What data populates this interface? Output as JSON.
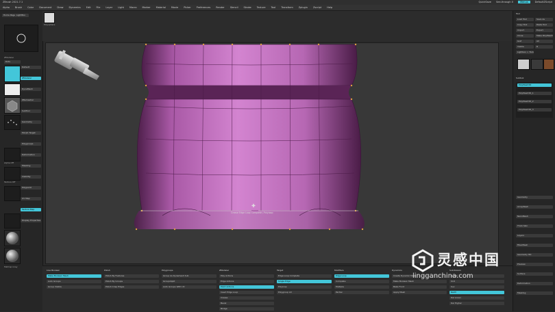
{
  "window": {
    "title": "ZBrush 2021.7.1",
    "status_right": [
      "QuickSave",
      "See-through 0",
      "Menus",
      "DefaultZScript"
    ]
  },
  "menu": {
    "items": [
      "Alpha",
      "Brush",
      "Color",
      "Document",
      "Draw",
      "Dynamics",
      "Edit",
      "File",
      "Layer",
      "Light",
      "Macro",
      "Marker",
      "Material",
      "Movie",
      "Picker",
      "Preferences",
      "Render",
      "Stencil",
      "Stroke",
      "Texture",
      "Tool",
      "Transform",
      "Zplugin",
      "Zscript",
      "Help"
    ]
  },
  "left_panel": {
    "buttons": [
      "Home Page",
      "LightBox",
      "Default",
      "ZModeler",
      "DynaMesh",
      "ZRemesher",
      "SubTool",
      "Geometry",
      "Morph Target",
      "Polygroups",
      "Deformation",
      "Masking",
      "Visibility",
      "Polypaint",
      "UV Map",
      "Texture Map",
      "Display Properties"
    ],
    "brush_label": "ZModeler",
    "stroke_label": "Dots",
    "alpha_label": "Alpha Off",
    "texture_label": "Texture Off",
    "material_label": "MatCap Gray"
  },
  "right_panel": {
    "header": "Tool",
    "buttons": [
      "Load Tool",
      "Save As",
      "Copy Tool",
      "Paste Tool",
      "Import",
      "Export",
      "Clone",
      "Make PolyMesh3D",
      "GoZ",
      "All",
      "Visible",
      "R",
      "Lightbox > Tools"
    ],
    "subtool_header": "Subtool",
    "subtools": [
      "PolyMesh3D",
      "PolyMesh3D_1",
      "PolyMesh3D_2",
      "PolyMesh3D_3"
    ],
    "sections": [
      "Geometry",
      "ArrayMesh",
      "NanoMesh",
      "Thick Skin",
      "Layers",
      "FiberMesh",
      "Geometry HD",
      "Preview",
      "Surface",
      "Deformation",
      "Masking"
    ]
  },
  "shelf": {
    "projection_label": "Polysphere"
  },
  "viewport": {
    "status_text": "Crease Edge Loop Complete / Polyloop"
  },
  "bottom_panel": {
    "groups": [
      {
        "title": "Live Boolean",
        "items": [
          "Make Boolean Mesh",
          "Auto Groups",
          "Group Visible"
        ]
      },
      {
        "title": "Polish",
        "items": [
          "Polish By Features",
          "Polish By Groups",
          "Polish Crisp Edges"
        ]
      },
      {
        "title": "Polygroups",
        "items": [
          "Group As Dynamesh Sub",
          "GroupsSplit",
          "Auto Groups With UV"
        ]
      },
      {
        "title": "ZModeler",
        "items": [
          "Poly Actions",
          "Edge Actions",
          "Point Actions",
          "Insert Edge Loop",
          "Crease",
          "Bevel",
          "Bridge"
        ]
      },
      {
        "title": "Target",
        "items": [
          "Edge Loop Complete",
          "Single Edge",
          "Polyloop",
          "Polygroup All"
        ]
      },
      {
        "title": "Modifiers",
        "items": [
          "Edge Loop",
          "Complete",
          "Multiple",
          "Partial"
        ]
      },
      {
        "title": "Dynamics",
        "items": [
          "Create Dynamic Mesh",
          "Make Boolean Mesh",
          "Bake Front",
          "Apply Mesh"
        ]
      },
      {
        "title": "Subdivision",
        "items": [
          "Divide",
          "Smt",
          "Suv",
          "ReUV",
          "Del Lower",
          "Del Higher"
        ]
      }
    ]
  },
  "watermark": {
    "title": "灵感中国",
    "url": "lingganchina.com"
  },
  "colors": {
    "accent": "#43c6d9",
    "mesh": "#c26fbf",
    "mesh_dark": "#6e2e6a",
    "panel": "#262626"
  }
}
